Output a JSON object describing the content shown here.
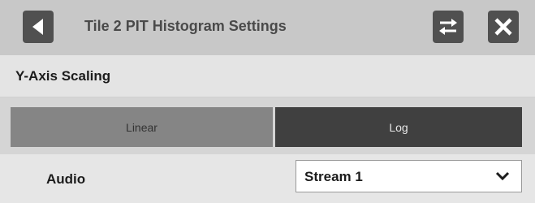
{
  "dialog": {
    "title": "Tile 2 PIT Histogram Settings",
    "back_icon": "back-arrow-icon",
    "swap_icon": "swap-icon",
    "close_icon": "close-icon"
  },
  "y_axis": {
    "heading": "Y-Axis Scaling",
    "options": [
      "Linear",
      "Log"
    ],
    "selected": "Log"
  },
  "audio": {
    "label": "Audio",
    "value": "Stream 1",
    "dropdown_icon": "chevron-down-icon"
  },
  "colors": {
    "titlebar": "#c8c8c8",
    "icon_button": "#505050",
    "segment_unselected": "#858585",
    "segment_selected": "#404040"
  }
}
